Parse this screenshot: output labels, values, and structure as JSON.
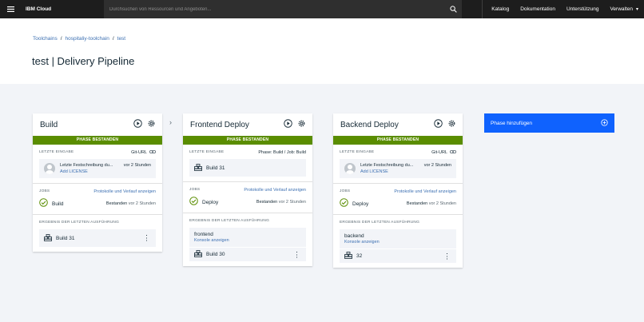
{
  "topbar": {
    "menu_icon": "hamburger-icon",
    "brand": "IBM Cloud",
    "search_placeholder": "Durchsuchen von Ressourcen und Angeboten...",
    "nav": [
      "Katalog",
      "Dokumentation",
      "Unterstützung",
      "Verwalten"
    ]
  },
  "breadcrumb": [
    "Toolchains",
    "hospitaliy-toolchain",
    "test"
  ],
  "page_title": "test | Delivery Pipeline",
  "stages": [
    {
      "title": "Build",
      "status": "PHASE BESTANDEN",
      "input": {
        "label": "LETZTE EINGABE",
        "right": "Git-URL",
        "commit_message": "Letzte Festschreibung du...",
        "commit_time": "vor 2 Stunden",
        "commit_link": "Add LICENSE"
      },
      "jobs": {
        "label": "JOBS",
        "link": "Protokolle und Verlauf anzeigen",
        "name": "Build",
        "status": "Bestanden",
        "time": "vor 2 Stunden"
      },
      "result": {
        "label": "ERGEBNIS DER LETZTEN AUSFÜHRUNG",
        "build": "Build 31"
      }
    },
    {
      "title": "Frontend Deploy",
      "status": "PHASE BESTANDEN",
      "input": {
        "label": "LETZTE EINGABE",
        "right": "Phase: Build  /  Job: Build",
        "build": "Build 31"
      },
      "jobs": {
        "label": "JOBS",
        "link": "Protokolle und Verlauf anzeigen",
        "name": "Deploy",
        "status": "Bestanden",
        "time": "vor 2 Stunden"
      },
      "result": {
        "label": "ERGEBNIS DER LETZTEN AUSFÜHRUNG",
        "app": "frontend",
        "console_link": "Konsole anzeigen",
        "build": "Build 30"
      }
    },
    {
      "title": "Backend Deploy",
      "status": "PHASE BESTANDEN",
      "input": {
        "label": "LETZTE EINGABE",
        "right": "Git-URL",
        "commit_message": "Letzte Festschreibung du...",
        "commit_time": "vor 2 Stunden",
        "commit_link": "Add LICENSE"
      },
      "jobs": {
        "label": "JOBS",
        "link": "Protokolle und Verlauf anzeigen",
        "name": "Deploy",
        "status": "Bestanden",
        "time": "vor 2 Stunden"
      },
      "result": {
        "label": "ERGEBNIS DER LETZTEN AUSFÜHRUNG",
        "app": "backend",
        "console_link": "Konsole anzeigen",
        "build": "32"
      }
    }
  ],
  "add_phase": {
    "label": "Phase hinzufügen",
    "icon": "plus-circle-icon"
  },
  "colors": {
    "passed": "#5a8d00",
    "link": "#3d70b2",
    "primary": "#0f62fe",
    "topbar": "#1d1d1d"
  }
}
